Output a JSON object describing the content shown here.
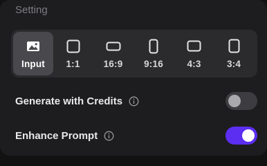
{
  "setting": {
    "title": "Setting"
  },
  "aspect_ratio": {
    "selected": "Input",
    "options": [
      {
        "label": "Input",
        "icon": "image-icon"
      },
      {
        "label": "1:1",
        "icon": "square-ratio-icon"
      },
      {
        "label": "16:9",
        "icon": "landscape-ratio-icon"
      },
      {
        "label": "9:16",
        "icon": "portrait-ratio-icon"
      },
      {
        "label": "4:3",
        "icon": "landscape-ratio-icon"
      },
      {
        "label": "3:4",
        "icon": "portrait-ratio-icon"
      }
    ]
  },
  "generate_with_credits": {
    "label": "Generate with Credits",
    "enabled": false,
    "info_icon": "info-icon"
  },
  "enhance_prompt": {
    "label": "Enhance Prompt",
    "enabled": true,
    "info_icon": "info-icon"
  },
  "colors": {
    "accent": "#5b2ef2",
    "panel": "#1d1d1f",
    "selected_option": "#49494d"
  }
}
